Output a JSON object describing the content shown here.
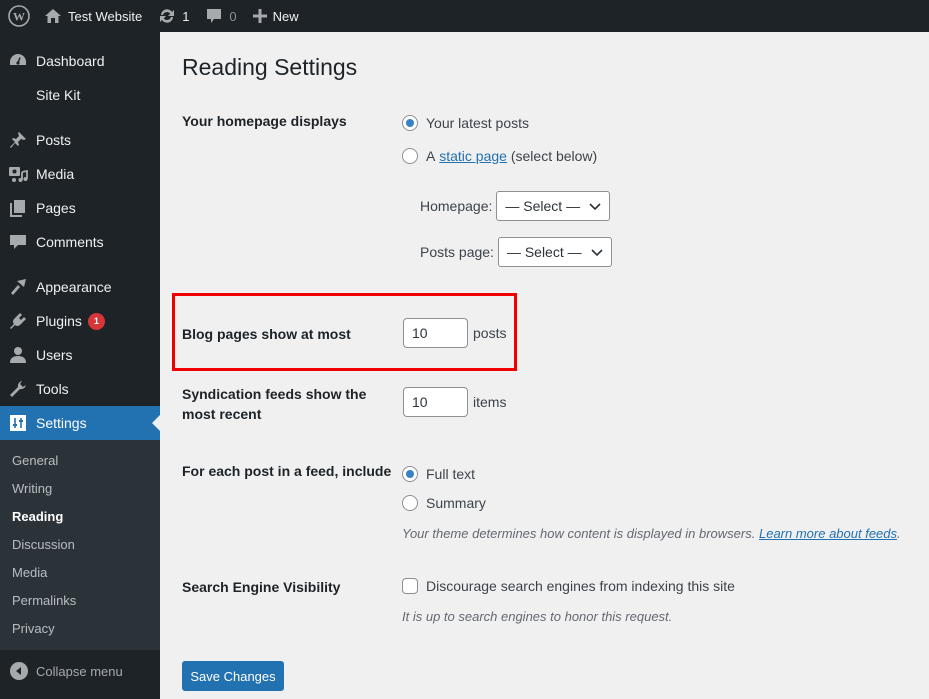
{
  "admin_bar": {
    "site_name": "Test Website",
    "updates_count": "1",
    "comments_count": "0",
    "new_label": "New"
  },
  "sidebar": {
    "items": [
      {
        "label": "Dashboard",
        "icon": "dashboard-icon"
      },
      {
        "label": "Site Kit",
        "icon": "site-kit-icon"
      },
      {
        "label": "Posts",
        "icon": "pin-icon"
      },
      {
        "label": "Media",
        "icon": "media-icon"
      },
      {
        "label": "Pages",
        "icon": "pages-icon"
      },
      {
        "label": "Comments",
        "icon": "comment-icon"
      },
      {
        "label": "Appearance",
        "icon": "brush-icon"
      },
      {
        "label": "Plugins",
        "icon": "plug-icon",
        "badge": "1"
      },
      {
        "label": "Users",
        "icon": "user-icon"
      },
      {
        "label": "Tools",
        "icon": "wrench-icon"
      },
      {
        "label": "Settings",
        "icon": "settings-icon",
        "current": true
      }
    ],
    "submenu": [
      {
        "label": "General"
      },
      {
        "label": "Writing"
      },
      {
        "label": "Reading",
        "current": true
      },
      {
        "label": "Discussion"
      },
      {
        "label": "Media"
      },
      {
        "label": "Permalinks"
      },
      {
        "label": "Privacy"
      }
    ],
    "collapse_label": "Collapse menu"
  },
  "main": {
    "title": "Reading Settings",
    "homepage_displays": {
      "label": "Your homepage displays",
      "option_latest": "Your latest posts",
      "option_static_prefix": "A",
      "option_static_link": "static page",
      "option_static_suffix": "(select below)",
      "selected": "latest",
      "homepage_label": "Homepage:",
      "homepage_value": "— Select —",
      "posts_page_label": "Posts page:",
      "posts_page_value": "— Select —"
    },
    "blog_pages": {
      "label": "Blog pages show at most",
      "value": "10",
      "suffix": "posts"
    },
    "syndication": {
      "label": "Syndication feeds show the most recent",
      "value": "10",
      "suffix": "items"
    },
    "feed_include": {
      "label": "For each post in a feed, include",
      "option_full": "Full text",
      "option_summary": "Summary",
      "selected": "full",
      "description": "Your theme determines how content is displayed in browsers.",
      "description_link": "Learn more about feeds",
      "description_end": "."
    },
    "search_visibility": {
      "label": "Search Engine Visibility",
      "checkbox_label": "Discourage search engines from indexing this site",
      "checked": false,
      "description": "It is up to search engines to honor this request."
    },
    "save_label": "Save Changes"
  },
  "colors": {
    "accent": "#2271b1",
    "highlight_box": "#ee0000",
    "badge": "#d63638",
    "sidebar_bg": "#1d2327"
  }
}
